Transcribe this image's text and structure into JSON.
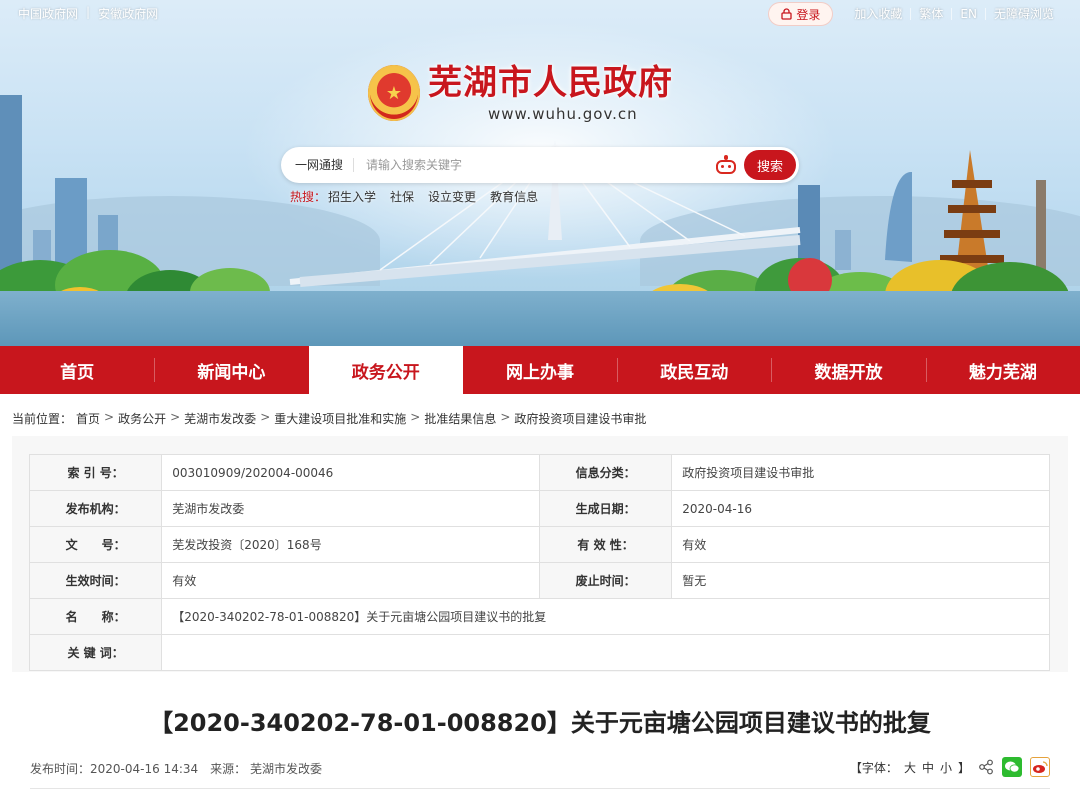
{
  "topbar": {
    "left_links": [
      "中国政府网",
      "安徽政府网"
    ],
    "login_label": "登录",
    "right_links": [
      "加入收藏",
      "繁体",
      "EN",
      "无障碍浏览"
    ]
  },
  "site": {
    "title": "芜湖市人民政府",
    "url": "www.wuhu.gov.cn"
  },
  "search": {
    "scope": "一网通搜",
    "placeholder": "请输入搜索关键字",
    "button": "搜索",
    "hot_label": "热搜：",
    "hot_terms": [
      "招生入学",
      "社保",
      "设立变更",
      "教育信息"
    ]
  },
  "nav": {
    "items": [
      "首页",
      "新闻中心",
      "政务公开",
      "网上办事",
      "政民互动",
      "数据开放",
      "魅力芜湖"
    ],
    "active_index": 2
  },
  "breadcrumb": {
    "prefix": "当前位置：",
    "items": [
      "首页",
      "政务公开",
      "芜湖市发改委",
      "重大建设项目批准和实施",
      "批准结果信息",
      "政府投资项目建设书审批"
    ]
  },
  "info": {
    "index_label": "索 引 号：",
    "index_value": "003010909/202004-00046",
    "category_label": "信息分类：",
    "category_value": "政府投资项目建设书审批",
    "publisher_label": "发布机构：",
    "publisher_value": "芜湖市发改委",
    "date_label": "生成日期：",
    "date_value": "2020-04-16",
    "docno_label": "文　　号：",
    "docno_value": "芜发改投资〔2020〕168号",
    "validity_label": "有 效 性：",
    "validity_value": "有效",
    "effective_label": "生效时间：",
    "effective_value": "有效",
    "expiry_label": "废止时间：",
    "expiry_value": "暂无",
    "name_label": "名　　称：",
    "name_value": "【2020-340202-78-01-008820】关于元亩塘公园项目建议书的批复",
    "keywords_label": "关 键 词：",
    "keywords_value": ""
  },
  "article": {
    "title": "【2020-340202-78-01-008820】关于元亩塘公园项目建议书的批复",
    "publish_label": "发布时间：",
    "publish_time": "2020-04-16 14:34",
    "source_label": "来源：",
    "source": "芜湖市发改委",
    "font_label": "【字体：",
    "font_sizes": [
      "大",
      "中",
      "小"
    ],
    "font_close": "】"
  },
  "colors": {
    "brand_red": "#c8161d",
    "wechat_green": "#2dbb2f"
  }
}
